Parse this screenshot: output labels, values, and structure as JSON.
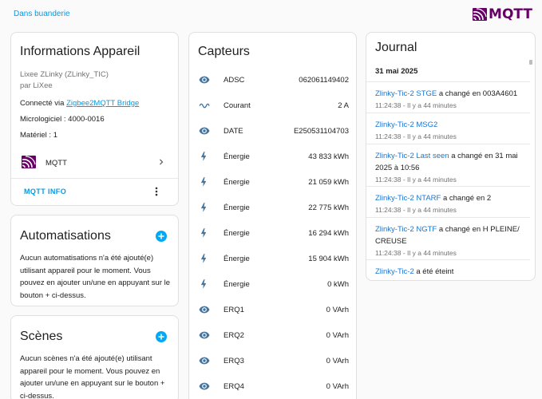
{
  "header": {
    "area_link": "Dans buanderie",
    "logo_text": "MQTT",
    "logo_color": "#660066"
  },
  "device": {
    "title": "Informations Appareil",
    "model": "Lixee ZLinky (ZLinky_TIC)",
    "manufacturer": "par LiXee",
    "connected_prefix": "Connecté via ",
    "connected_link": "Zigbee2MQTT Bridge",
    "firmware": "Micrologiciel : 4000-0016",
    "hardware": "Matériel : 1",
    "integration_label": "MQTT",
    "mqtt_info_button": "MQTT INFO"
  },
  "automations": {
    "title": "Automatisations",
    "body": "Aucun automatisations n'a été ajouté(e) utilisant appareil pour le moment. Vous pouvez en ajouter un/une en appuyant sur le bouton + ci-dessus."
  },
  "scenes": {
    "title": "Scènes",
    "body": "Aucun scènes n'a été ajouté(e) utilisant appareil pour le moment. Vous pouvez en ajouter un/une en appuyant sur le bouton + ci-dessus."
  },
  "sensors": {
    "title": "Capteurs",
    "icon_color": "#44739e",
    "rows": [
      {
        "icon": "eye-icon",
        "name": "ADSC",
        "value": "062061149402"
      },
      {
        "icon": "current-ac-icon",
        "name": "Courant",
        "value": "2 A"
      },
      {
        "icon": "eye-icon",
        "name": "DATE",
        "value": "E250531104703"
      },
      {
        "icon": "lightning-icon",
        "name": "Énergie",
        "value": "43 833 kWh"
      },
      {
        "icon": "lightning-icon",
        "name": "Énergie",
        "value": "21 059 kWh"
      },
      {
        "icon": "lightning-icon",
        "name": "Énergie",
        "value": "22 775 kWh"
      },
      {
        "icon": "lightning-icon",
        "name": "Énergie",
        "value": "16 294 kWh"
      },
      {
        "icon": "lightning-icon",
        "name": "Énergie",
        "value": "15 904 kWh"
      },
      {
        "icon": "lightning-icon",
        "name": "Énergie",
        "value": "0 kWh"
      },
      {
        "icon": "eye-icon",
        "name": "ERQ1",
        "value": "0 VArh"
      },
      {
        "icon": "eye-icon",
        "name": "ERQ2",
        "value": "0 VArh"
      },
      {
        "icon": "eye-icon",
        "name": "ERQ3",
        "value": "0 VArh"
      },
      {
        "icon": "eye-icon",
        "name": "ERQ4",
        "value": "0 VArh"
      }
    ]
  },
  "journal": {
    "title": "Journal",
    "date": "31 mai 2025",
    "entries": [
      {
        "name": "Zlinky-Tic-2 STGE",
        "message": " a changé en 003A4601",
        "time": "11:24:38 - Il y a 44 minutes"
      },
      {
        "name": "Zlinky-Tic-2 MSG2",
        "message": "",
        "time": "11:24:38 - Il y a 44 minutes"
      },
      {
        "name": "Zlinky-Tic-2 Last seen",
        "message": " a changé en 31 mai 2025 à 10:56",
        "time": "11:24:38 - Il y a 44 minutes"
      },
      {
        "name": "Zlinky-Tic-2 NTARF",
        "message": " a changé en 2",
        "time": "11:24:38 - Il y a 44 minutes"
      },
      {
        "name": "Zlinky-Tic-2 NGTF",
        "message": " a changé en H PLEINE/ CREUSE",
        "time": "11:24:38 - Il y a 44 minutes"
      },
      {
        "name": "Zlinky-Tic-2",
        "message": " a été éteint",
        "time": ""
      }
    ]
  }
}
